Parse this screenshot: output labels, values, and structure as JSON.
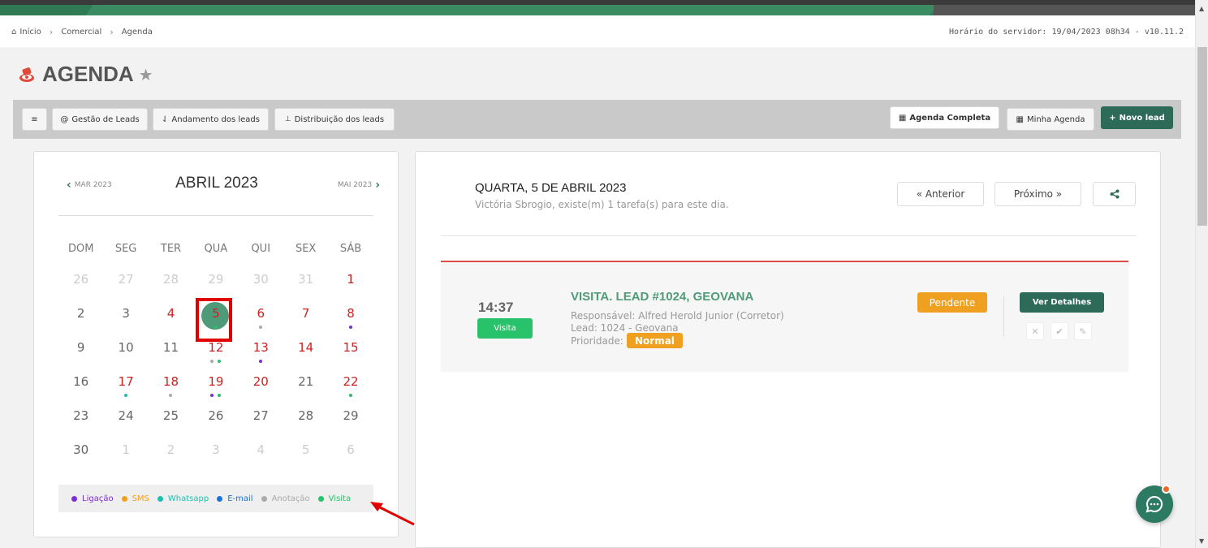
{
  "breadcrumb": {
    "items": [
      "Início",
      "Comercial",
      "Agenda"
    ],
    "server_time": "Horário do servidor: 19/04/2023 08h34 - v10.11.2"
  },
  "page": {
    "title": "AGENDA"
  },
  "toolbar": {
    "menu_label": "≡",
    "gestao": "Gestão de Leads",
    "andamento": "Andamento dos leads",
    "distribuicao": "Distribuição dos leads",
    "agenda_completa": "Agenda Completa",
    "minha_agenda": "Minha Agenda",
    "novo_lead": "Novo lead"
  },
  "calendar": {
    "prev_month": "MAR 2023",
    "next_month": "MAI 2023",
    "title": "ABRIL 2023",
    "weekdays": [
      "DOM",
      "SEG",
      "TER",
      "QUA",
      "QUI",
      "SEX",
      "SÁB"
    ],
    "weeks": [
      [
        {
          "d": "26",
          "m": true
        },
        {
          "d": "27",
          "m": true
        },
        {
          "d": "28",
          "m": true
        },
        {
          "d": "29",
          "m": true
        },
        {
          "d": "30",
          "m": true
        },
        {
          "d": "31",
          "m": true
        },
        {
          "d": "1",
          "r": true
        }
      ],
      [
        {
          "d": "2"
        },
        {
          "d": "3"
        },
        {
          "d": "4",
          "r": true
        },
        {
          "d": "5",
          "r": true,
          "today": true,
          "dots": [
            "#27c269"
          ]
        },
        {
          "d": "6",
          "r": true,
          "dots": [
            "#aaaaaa"
          ]
        },
        {
          "d": "7",
          "r": true
        },
        {
          "d": "8",
          "r": true,
          "dots": [
            "#7b2fd1"
          ]
        }
      ],
      [
        {
          "d": "9"
        },
        {
          "d": "10"
        },
        {
          "d": "11"
        },
        {
          "d": "12",
          "r": true,
          "dots": [
            "#aaaaaa",
            "#27c269"
          ]
        },
        {
          "d": "13",
          "r": true,
          "dots": [
            "#7b2fd1"
          ]
        },
        {
          "d": "14",
          "r": true
        },
        {
          "d": "15",
          "r": true
        }
      ],
      [
        {
          "d": "16"
        },
        {
          "d": "17",
          "r": true,
          "dots": [
            "#1fbfb0"
          ]
        },
        {
          "d": "18",
          "r": true,
          "dots": [
            "#aaaaaa"
          ]
        },
        {
          "d": "19",
          "r": true,
          "dots": [
            "#7b2fd1",
            "#27c269"
          ]
        },
        {
          "d": "20",
          "r": true
        },
        {
          "d": "21"
        },
        {
          "d": "22",
          "r": true,
          "dots": [
            "#27c269"
          ]
        }
      ],
      [
        {
          "d": "23"
        },
        {
          "d": "24"
        },
        {
          "d": "25"
        },
        {
          "d": "26"
        },
        {
          "d": "27"
        },
        {
          "d": "28"
        },
        {
          "d": "29"
        }
      ],
      [
        {
          "d": "30"
        },
        {
          "d": "1",
          "m": true
        },
        {
          "d": "2",
          "m": true
        },
        {
          "d": "3",
          "m": true
        },
        {
          "d": "4",
          "m": true
        },
        {
          "d": "5",
          "m": true
        },
        {
          "d": "6",
          "m": true
        }
      ]
    ],
    "legend": [
      {
        "label": "Ligação",
        "color": "#7b2fd1"
      },
      {
        "label": "SMS",
        "color": "#f0a020"
      },
      {
        "label": "Whatsapp",
        "color": "#1fbfb0"
      },
      {
        "label": "E-mail",
        "color": "#1a73d9"
      },
      {
        "label": "Anotação",
        "color": "#aaaaaa"
      },
      {
        "label": "Visita",
        "color": "#27c269"
      }
    ]
  },
  "day": {
    "title": "QUARTA, 5 DE ABRIL 2023",
    "subtitle": "Victória Sbrogio, existe(m) 1 tarefa(s) para este dia.",
    "prev_label": "« Anterior",
    "next_label": "Próximo »"
  },
  "task": {
    "time": "14:37",
    "type": "Visita",
    "title": "VISITA. LEAD #1024, GEOVANA",
    "responsavel": "Responsável: Alfred Herold Junior (Corretor)",
    "lead": "Lead: 1024 - Geovana",
    "prioridade_label": "Prioridade:",
    "prioridade": "Normal",
    "status": "Pendente",
    "details_label": "Ver Detalhes"
  },
  "colors": {
    "brand_green": "#2d6b58",
    "accent_green": "#4f9a79",
    "warning": "#f0a020",
    "success": "#27c269"
  }
}
